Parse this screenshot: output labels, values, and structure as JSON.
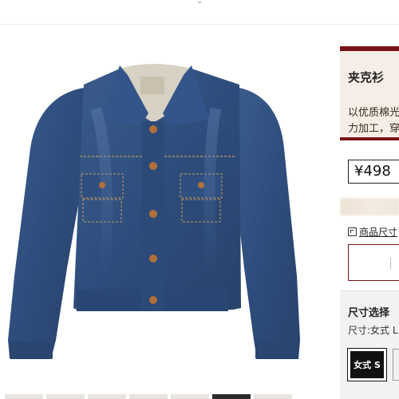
{
  "top_bar": {
    "chevron_icon": "chevron-down-icon"
  },
  "product": {
    "image_icon": "denim-jacket-photo",
    "colors": {
      "accent": "#7a1318",
      "panel_bg": "#f5eee6",
      "denim": "#2f4f7e"
    }
  },
  "info_panel": {
    "title": "夹克衫",
    "description_lines": [
      "以优质棉光",
      "力加工，穿"
    ],
    "price": "¥498",
    "size_chart_icon": "size-chart-icon",
    "size_chart_label": "商品尺寸"
  },
  "size_selector": {
    "heading": "尺寸选择",
    "current": "尺寸:女式 L",
    "options": [
      {
        "label": "女式 S",
        "selected": true
      },
      {
        "label": "",
        "selected": false
      }
    ]
  }
}
